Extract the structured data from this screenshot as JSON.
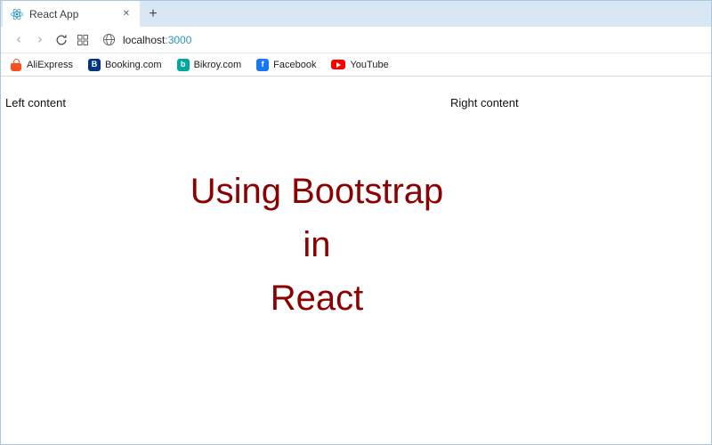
{
  "browser": {
    "tab": {
      "title": "React App",
      "close_icon": "✕",
      "new_tab_icon": "+",
      "logo_color": "#0a8fb2"
    },
    "nav": {
      "back_icon": "‹",
      "forward_icon": "›",
      "url_host": "localhost",
      "url_port": ":3000",
      "url_port_color": "#2596be"
    },
    "bookmarks": [
      {
        "label": "AliExpress",
        "brand_color": "#f4511e"
      },
      {
        "label": "Booking.com",
        "brand_color": "#003580",
        "glyph": "B"
      },
      {
        "label": "Bikroy.com",
        "brand_color": "#00a79d",
        "glyph": "b"
      },
      {
        "label": "Facebook",
        "brand_color": "#1877f2",
        "glyph": "f"
      },
      {
        "label": "YouTube",
        "brand_color": "#ff0000"
      }
    ]
  },
  "page": {
    "left_column_text": "Left content",
    "right_column_text": "Right content",
    "heading_lines": [
      "Using Bootstrap",
      "in",
      "React"
    ],
    "heading_color": "#8b0000"
  }
}
